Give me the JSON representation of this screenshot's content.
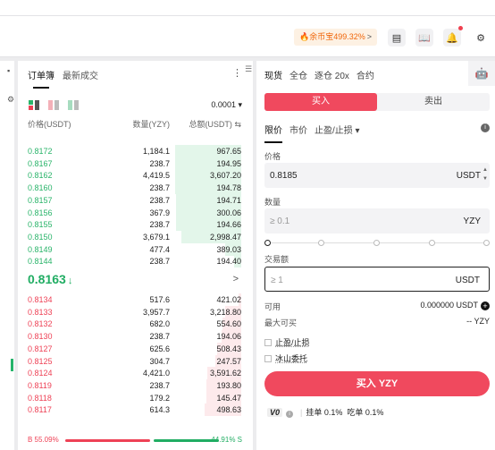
{
  "header": {
    "promo_text": "余币宝499.32%",
    "promo_arrow": ">"
  },
  "orderbook": {
    "tabs": [
      "订单簿",
      "最新成交"
    ],
    "tick_size": "0.0001",
    "columns": {
      "price": "价格(USDT)",
      "qty": "数量(YZY)",
      "total": "总额(USDT)"
    },
    "asks": [
      {
        "price": "0.8172",
        "qty": "1,184.1",
        "total": "967.65",
        "depth": 0.53
      },
      {
        "price": "0.8167",
        "qty": "238.7",
        "total": "194.95",
        "depth": 0.53
      },
      {
        "price": "0.8162",
        "qty": "4,419.5",
        "total": "3,607.20",
        "depth": 0.53
      },
      {
        "price": "0.8160",
        "qty": "238.7",
        "total": "194.78",
        "depth": 0.53
      },
      {
        "price": "0.8157",
        "qty": "238.7",
        "total": "194.71",
        "depth": 0.52
      },
      {
        "price": "0.8156",
        "qty": "367.9",
        "total": "300.06",
        "depth": 0.52
      },
      {
        "price": "0.8155",
        "qty": "238.7",
        "total": "194.66",
        "depth": 0.52
      },
      {
        "price": "0.8150",
        "qty": "3,679.1",
        "total": "2,998.47",
        "depth": 0.48
      },
      {
        "price": "0.8149",
        "qty": "477.4",
        "total": "389.03",
        "depth": 0.13
      },
      {
        "price": "0.8144",
        "qty": "238.7",
        "total": "194.40",
        "depth": 0.06
      }
    ],
    "mid_price": "0.8163",
    "mid_arrow": "↓",
    "mid_chevron": ">",
    "bids": [
      {
        "price": "0.8134",
        "qty": "517.6",
        "total": "421.02",
        "depth": 0.02
      },
      {
        "price": "0.8133",
        "qty": "3,957.7",
        "total": "3,218.80",
        "depth": 0.13
      },
      {
        "price": "0.8132",
        "qty": "682.0",
        "total": "554.60",
        "depth": 0.15
      },
      {
        "price": "0.8130",
        "qty": "238.7",
        "total": "194.06",
        "depth": 0.16
      },
      {
        "price": "0.8127",
        "qty": "625.6",
        "total": "508.43",
        "depth": 0.19
      },
      {
        "price": "0.8125",
        "qty": "304.7",
        "total": "247.57",
        "depth": 0.21
      },
      {
        "price": "0.8124",
        "qty": "4,421.0",
        "total": "3,591.62",
        "depth": 0.27
      },
      {
        "price": "0.8119",
        "qty": "238.7",
        "total": "193.80",
        "depth": 0.28
      },
      {
        "price": "0.8118",
        "qty": "179.2",
        "total": "145.47",
        "depth": 0.28
      },
      {
        "price": "0.8117",
        "qty": "614.3",
        "total": "498.63",
        "depth": 0.29
      }
    ],
    "buy_ratio_label": "B 55.09%",
    "sell_ratio_label": "44.91% S",
    "buy_ratio": 0.5509
  },
  "trade": {
    "tabs": [
      "现货",
      "全仓",
      "逐仓 20x",
      "合约"
    ],
    "buy_label": "买入",
    "sell_label": "卖出",
    "order_types": [
      "限价",
      "市价",
      "止盈/止损 ▾"
    ],
    "price_label": "价格",
    "price_value": "0.8185",
    "price_unit": "USDT",
    "qty_label": "数量",
    "qty_placeholder": "≥ 0.1",
    "qty_unit": "YZY",
    "amount_label": "交易额",
    "amount_placeholder": "≥ 1",
    "amount_unit": "USDT",
    "available_label": "可用",
    "available_value": "0.000000 USDT",
    "max_buy_label": "最大可买",
    "max_buy_value": "-- YZY",
    "tp_sl_label": "止盈/止损",
    "iceberg_label": "冰山委托",
    "submit_label": "买入 YZY",
    "vip_label": "V0",
    "maker_fee": "挂单 0.1%",
    "taker_fee": "吃单 0.1%"
  },
  "colors": {
    "buy": "#f0495e",
    "ask_price": "#2ab46a",
    "bid_price": "#ee4256",
    "promo": "#f0660a"
  }
}
